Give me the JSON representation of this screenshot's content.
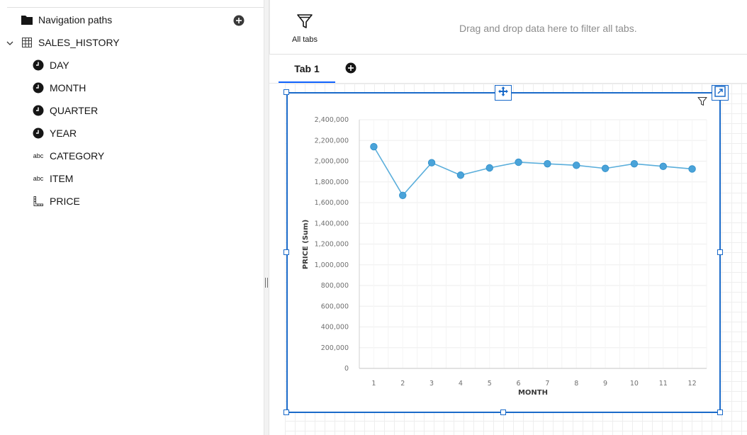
{
  "left_panel": {
    "items": [
      {
        "label": "Navigation paths",
        "icon": "folder-icon"
      },
      {
        "label": "SALES_HISTORY",
        "icon": "table-icon"
      },
      {
        "label": "DAY",
        "icon": "clock-icon"
      },
      {
        "label": "MONTH",
        "icon": "clock-icon"
      },
      {
        "label": "QUARTER",
        "icon": "clock-icon"
      },
      {
        "label": "YEAR",
        "icon": "clock-icon"
      },
      {
        "label": "CATEGORY",
        "icon": "abc-icon",
        "icon_text": "abc"
      },
      {
        "label": "ITEM",
        "icon": "abc-icon",
        "icon_text": "abc"
      },
      {
        "label": "PRICE",
        "icon": "ruler-icon"
      }
    ]
  },
  "filter_bar": {
    "all_tabs_label": "All tabs",
    "drop_hint": "Drag and drop data here to filter all tabs."
  },
  "tabs": [
    {
      "label": "Tab 1",
      "active": true
    }
  ],
  "colors": {
    "accent": "#1a6ac9",
    "tab_underline": "#0f62fe",
    "series_line": "#5aaedb",
    "series_point": "#4aa3d9"
  },
  "chart_data": {
    "type": "line",
    "xlabel": "MONTH",
    "ylabel": "PRICE (Sum)",
    "categories": [
      "1",
      "2",
      "3",
      "4",
      "5",
      "6",
      "7",
      "8",
      "9",
      "10",
      "11",
      "12"
    ],
    "series": [
      {
        "values": [
          2140000,
          1670000,
          1985000,
          1865000,
          1935000,
          1990000,
          1975000,
          1960000,
          1930000,
          1975000,
          1950000,
          1925000
        ]
      }
    ],
    "ylim": [
      0,
      2400000
    ],
    "yticks": [
      "0",
      "200,000",
      "400,000",
      "600,000",
      "800,000",
      "1,000,000",
      "1,200,000",
      "1,400,000",
      "1,600,000",
      "1,800,000",
      "2,000,000",
      "2,200,000",
      "2,400,000"
    ],
    "grid": true,
    "legend": false
  }
}
